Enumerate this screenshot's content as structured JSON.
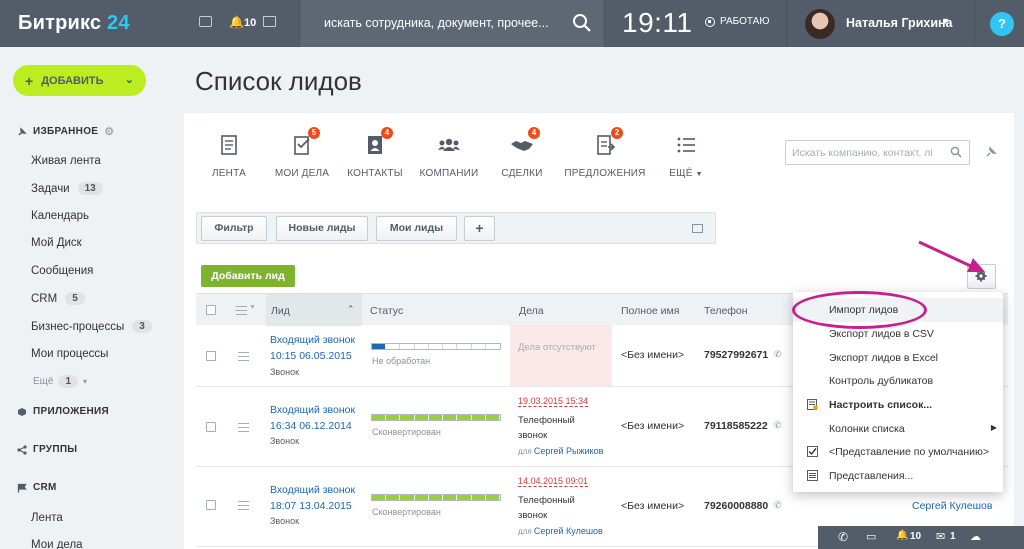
{
  "topbar": {
    "logo_name": "Битрикс",
    "logo_num": "24",
    "notifications_count": "10",
    "search_placeholder": "искать сотрудника, документ, прочее...",
    "clock": "19:11",
    "work_status": "РАБОТАЮ",
    "user_name": "Наталья Грихина",
    "help": "?"
  },
  "sidebar": {
    "add_button": "ДОБАВИТЬ",
    "favorites_header": "ИЗБРАННОЕ",
    "items": [
      {
        "label": "Живая лента",
        "badge": ""
      },
      {
        "label": "Задачи",
        "badge": "13"
      },
      {
        "label": "Календарь",
        "badge": ""
      },
      {
        "label": "Мой Диск",
        "badge": ""
      },
      {
        "label": "Сообщения",
        "badge": ""
      },
      {
        "label": "CRM",
        "badge": "5"
      },
      {
        "label": "Бизнес-процессы",
        "badge": "3"
      },
      {
        "label": "Мои процессы",
        "badge": ""
      }
    ],
    "more_label": "Ещё",
    "more_badge": "1",
    "apps_header": "ПРИЛОЖЕНИЯ",
    "groups_header": "ГРУППЫ",
    "crm_header": "CRM",
    "crm_items": [
      "Лента",
      "Мои дела"
    ]
  },
  "page": {
    "title": "Список лидов"
  },
  "toolbar": {
    "items": [
      {
        "label": "ЛЕНТА",
        "badge": "",
        "icon": "feed-icon"
      },
      {
        "label": "МОИ ДЕЛА",
        "badge": "5",
        "icon": "tasks-icon"
      },
      {
        "label": "КОНТАКТЫ",
        "badge": "4",
        "icon": "contacts-icon"
      },
      {
        "label": "КОМПАНИИ",
        "badge": "",
        "icon": "companies-icon"
      },
      {
        "label": "СДЕЛКИ",
        "badge": "4",
        "icon": "deals-icon"
      },
      {
        "label": "ПРЕДЛОЖЕНИЯ",
        "badge": "2",
        "icon": "quotes-icon"
      },
      {
        "label": "ЕЩЁ",
        "badge": "",
        "icon": "more-icon"
      }
    ],
    "search_placeholder": "Искать компанию, контакт, лі"
  },
  "filters": {
    "buttons": [
      "Фильтр",
      "Новые лиды",
      "Мои лиды",
      "+"
    ]
  },
  "actions": {
    "add_lead": "Добавить лид"
  },
  "table": {
    "headers": {
      "lead": "Лид",
      "status": "Статус",
      "deals": "Дела",
      "full_name": "Полное имя",
      "phone": "Телефон"
    },
    "rows": [
      {
        "title_line1": "Входящий звонок",
        "title_line2": "10:15 06.05.2015",
        "source": "Звонок",
        "status": "Не обработан",
        "status_progress": 0.11,
        "deal_none": "Дела отсутствуют",
        "deal_date": "",
        "deal_line1": "",
        "deal_line2": "",
        "deal_for": "",
        "deal_person": "",
        "full_name": "<Без имени>",
        "phone": "79527992671",
        "responsible": ""
      },
      {
        "title_line1": "Входящий звонок",
        "title_line2": "16:34 06.12.2014",
        "source": "Звонок",
        "status": "Сконвертирован",
        "status_progress": 1.0,
        "deal_none": "",
        "deal_date": "19.03.2015 15:34",
        "deal_line1": "Телефонный",
        "deal_line2": "звонок",
        "deal_for": "для",
        "deal_person": "Сергей Рыжиков",
        "full_name": "<Без имени>",
        "phone": "79118585222",
        "responsible": ""
      },
      {
        "title_line1": "Входящий звонок",
        "title_line2": "18:07 13.04.2015",
        "source": "Звонок",
        "status": "Сконвертирован",
        "status_progress": 1.0,
        "deal_none": "",
        "deal_date": "14.04.2015 09:01",
        "deal_line1": "Телефонный",
        "deal_line2": "звонок",
        "deal_for": "для",
        "deal_person": "Сергей Кулешов",
        "full_name": "<Без имени>",
        "phone": "79260008880",
        "responsible": "Сергей Кулешов"
      }
    ]
  },
  "settings_menu": {
    "items": [
      {
        "label": "Импорт лидов"
      },
      {
        "label": "Экспорт лидов в CSV"
      },
      {
        "label": "Экспорт лидов в Excel"
      },
      {
        "label": "Контроль дубликатов"
      },
      {
        "label": "Настроить список..."
      },
      {
        "label": "Колонки списка"
      },
      {
        "label": "<Представление по умолчанию>"
      },
      {
        "label": "Представления..."
      }
    ]
  },
  "bottombar": {
    "notifications_count": "10"
  },
  "colors": {
    "topbar": "#535c69",
    "accent": "#2fc6f6",
    "add_button": "#bbed21",
    "add_lead": "#7fb32f",
    "status_new": "#2067b0",
    "status_converted": "#9dcf3a",
    "annotation": "#c5208e"
  }
}
